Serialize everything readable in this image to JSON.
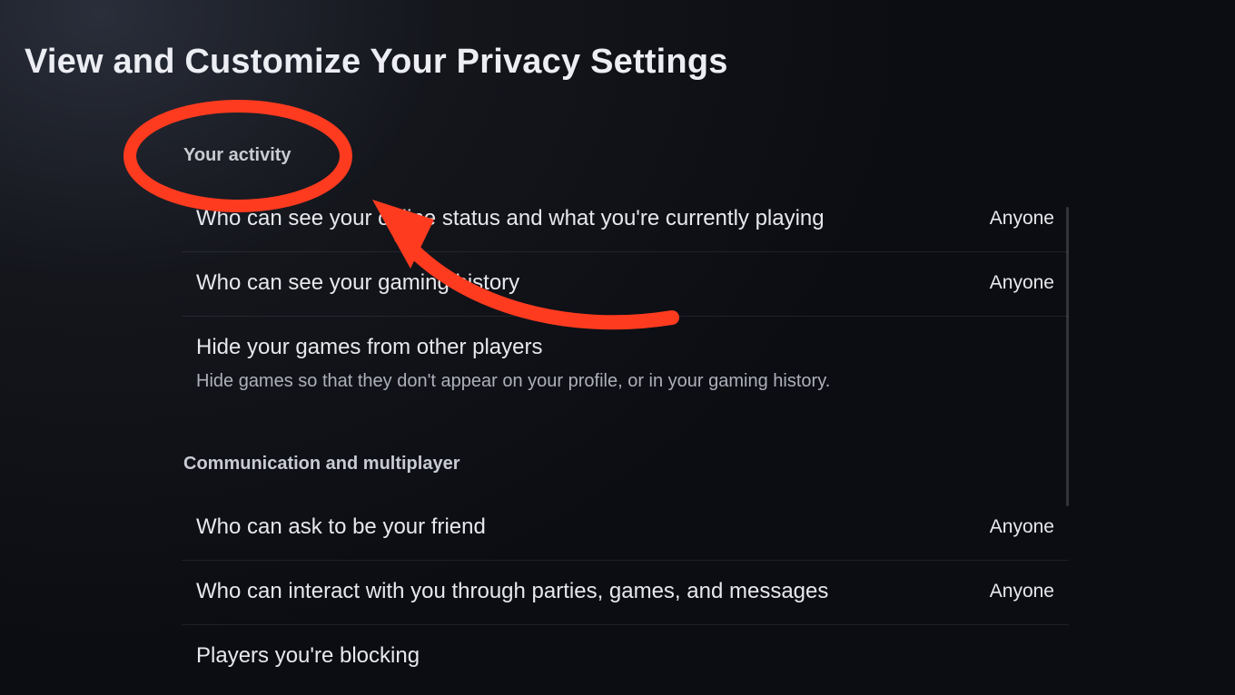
{
  "title": "View and Customize Your Privacy Settings",
  "sections": {
    "activity": {
      "heading": "Your activity",
      "items": [
        {
          "label": "Who can see your online status and what you're currently playing",
          "value": "Anyone"
        },
        {
          "label": "Who can see your gaming history",
          "value": "Anyone"
        },
        {
          "label": "Hide your games from other players",
          "sub": "Hide games so that they don't appear on your profile, or in your gaming history."
        }
      ]
    },
    "communication": {
      "heading": "Communication and multiplayer",
      "items": [
        {
          "label": "Who can ask to be your friend",
          "value": "Anyone"
        },
        {
          "label": "Who can interact with you through parties, games, and messages",
          "value": "Anyone"
        },
        {
          "label": "Players you're blocking"
        }
      ]
    }
  },
  "annotation": {
    "type": "circle-with-arrow",
    "color": "#ff3b1f"
  }
}
